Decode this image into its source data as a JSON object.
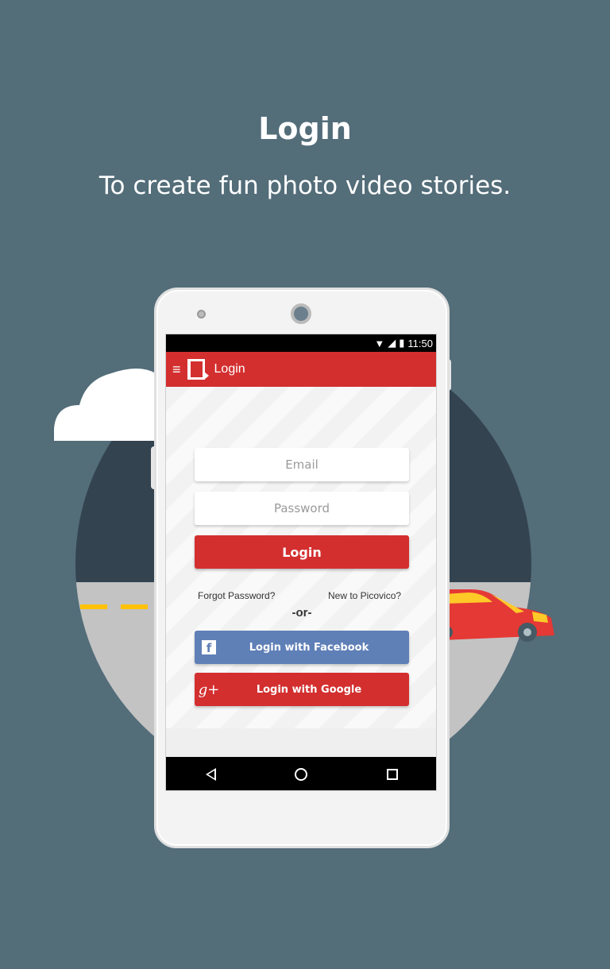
{
  "header": {
    "title": "Login",
    "subtitle": "To create fun photo video stories."
  },
  "phone": {
    "status": {
      "time": "11:50"
    },
    "appbar": {
      "title": "Login",
      "menu_icon": "hamburger-menu-icon",
      "logo_icon": "picovico-logo-icon"
    },
    "form": {
      "email_placeholder": "Email",
      "password_placeholder": "Password",
      "login_label": "Login",
      "forgot_label": "Forgot Password?",
      "new_label": "New to Picovico?",
      "or_label": "-or-",
      "facebook_label": "Login with Facebook",
      "google_label": "Login with Google",
      "facebook_icon": "f",
      "google_icon": "g+"
    },
    "navbar": {
      "back_icon": "back-triangle-icon",
      "home_icon": "home-circle-icon",
      "recents_icon": "recents-square-icon"
    }
  },
  "colors": {
    "background": "#536d79",
    "accent": "#d32f2f",
    "facebook": "#5f7fb7",
    "dark_circle": "#33434f",
    "road": "#c3c3c3",
    "car": "#e53935",
    "road_marks": "#ffc107"
  }
}
